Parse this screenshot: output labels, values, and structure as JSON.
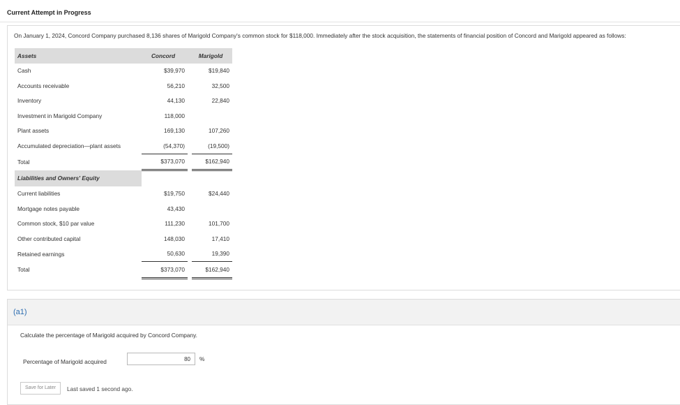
{
  "header": {
    "status": "Current Attempt in Progress"
  },
  "problem": {
    "intro": "On January 1, 2024, Concord Company purchased 8,136 shares of Marigold Company's common stock for $118,000. Immediately after the stock acquisition, the statements of financial position of Concord and Marigold appeared as follows:",
    "columns": {
      "label": "Assets",
      "concord": "Concord",
      "marigold": "Marigold"
    },
    "assets": [
      {
        "label": "Cash",
        "concord": "$39,970",
        "marigold": "$19,840"
      },
      {
        "label": "Accounts receivable",
        "concord": "56,210",
        "marigold": "32,500"
      },
      {
        "label": "Inventory",
        "concord": "44,130",
        "marigold": "22,840"
      },
      {
        "label": "Investment in Marigold Company",
        "concord": "118,000",
        "marigold": ""
      },
      {
        "label": "Plant assets",
        "concord": "169,130",
        "marigold": "107,260"
      },
      {
        "label": "Accumulated depreciation—plant assets",
        "concord": "(54,370)",
        "marigold": "(19,500)"
      }
    ],
    "assets_total": {
      "label": "Total",
      "concord": "$373,070",
      "marigold": "$162,940"
    },
    "liab_header": "Liabilities and Owners' Equity",
    "liabilities": [
      {
        "label": "Current liabilities",
        "concord": "$19,750",
        "marigold": "$24,440"
      },
      {
        "label": "Mortgage notes payable",
        "concord": "43,430",
        "marigold": ""
      },
      {
        "label": "Common stock, $10 par value",
        "concord": "111,230",
        "marigold": "101,700"
      },
      {
        "label": "Other contributed capital",
        "concord": "148,030",
        "marigold": "17,410"
      },
      {
        "label": "Retained earnings",
        "concord": "50,630",
        "marigold": "19,390"
      }
    ],
    "liab_total": {
      "label": "Total",
      "concord": "$373,070",
      "marigold": "$162,940"
    }
  },
  "part": {
    "label": "(a1)",
    "question": "Calculate the percentage of Marigold acquired by Concord Company.",
    "answer_label": "Percentage of Marigold acquired",
    "answer_value": "80",
    "unit": "%",
    "save_button": "Save for Later",
    "last_saved": "Last saved 1 second ago."
  }
}
